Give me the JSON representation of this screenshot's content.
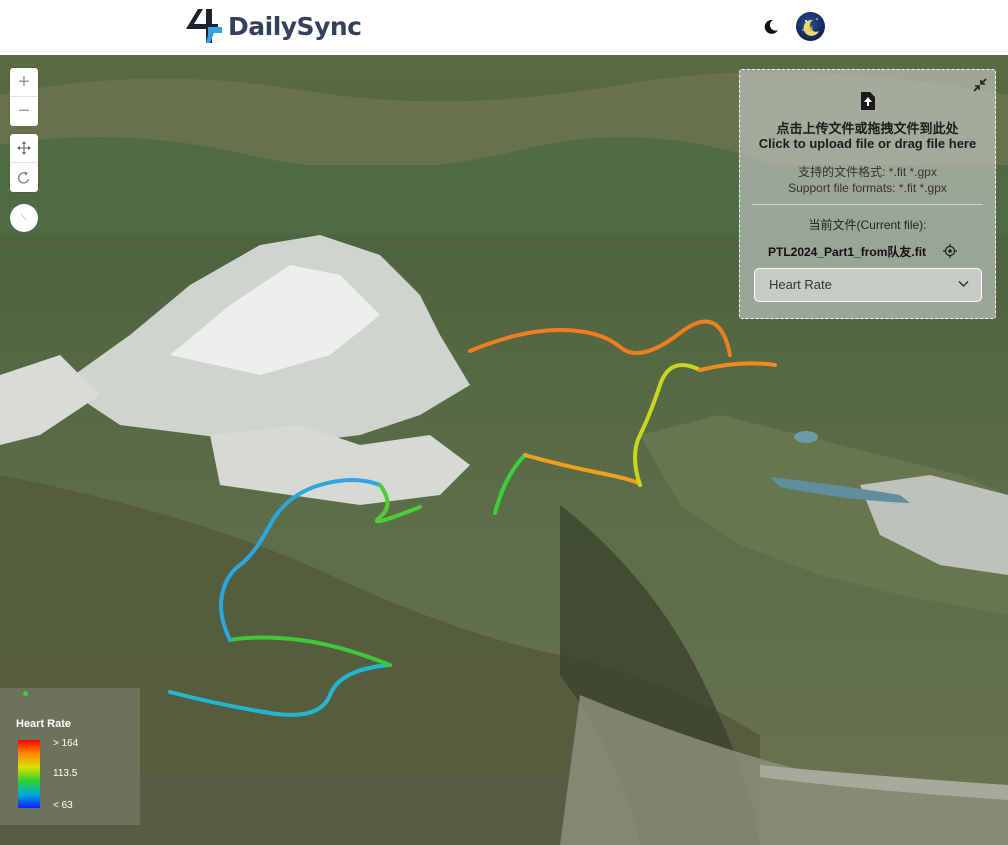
{
  "header": {
    "brand": "DailySync",
    "icons": {
      "logo": "dailysync-logo",
      "theme_toggle": "moon-icon",
      "avatar": "user-avatar"
    }
  },
  "map_controls": {
    "zoom_in_symbol": "+",
    "zoom_out_symbol": "−",
    "icons": [
      "move-icon",
      "rotate-icon",
      "compass-icon"
    ]
  },
  "upload_panel": {
    "upload_cn": "点击上传文件或拖拽文件到此处",
    "upload_en": "Click to upload file or drag file here",
    "formats_cn": "支持的文件格式: *.fit *.gpx",
    "formats_en": "Support file formats: *.fit *.gpx",
    "current_file_label": "当前文件(Current file):",
    "current_file": "PTL2024_Part1_from队友.fit",
    "metric_select": {
      "selected": "Heart Rate",
      "options_visible": [
        "Heart Rate"
      ]
    }
  },
  "legend": {
    "title": "Heart Rate",
    "max_label": "> 164",
    "mid_label": "113.5",
    "min_label": "< 63",
    "colors": [
      "#ff0000",
      "#ff8a00",
      "#d9e000",
      "#2ed12e",
      "#00aad8",
      "#1020ff"
    ]
  },
  "colors": {
    "brand_text": "#35405a",
    "brand_blue": "#3aa0e0",
    "brand_dark": "#1e2230"
  }
}
